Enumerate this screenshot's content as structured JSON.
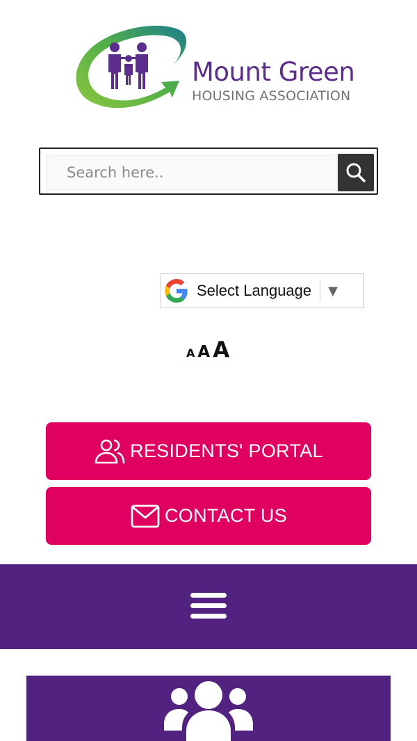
{
  "brand": {
    "name": "Mount Green",
    "subtitle": "HOUSING ASSOCIATION",
    "colors": {
      "purple": "#5b2d8c",
      "green": "#7dc242",
      "teal": "#1a8a8c",
      "gray": "#6f7278"
    }
  },
  "search": {
    "placeholder": "Search here..",
    "value": "",
    "button_icon": "search-icon"
  },
  "language": {
    "label": "Select Language",
    "icon": "google-g-icon",
    "arrow": "▼"
  },
  "font_size": {
    "small": "A",
    "medium": "A",
    "large": "A"
  },
  "buttons": {
    "portal": {
      "label": "RESIDENTS' PORTAL",
      "icon": "users-icon"
    },
    "contact": {
      "label": "CONTACT US",
      "icon": "envelope-icon"
    },
    "color": "#e0005f"
  },
  "nav": {
    "menu_icon": "hamburger-icon",
    "color": "#522280"
  },
  "panel": {
    "icon": "group-icon"
  }
}
